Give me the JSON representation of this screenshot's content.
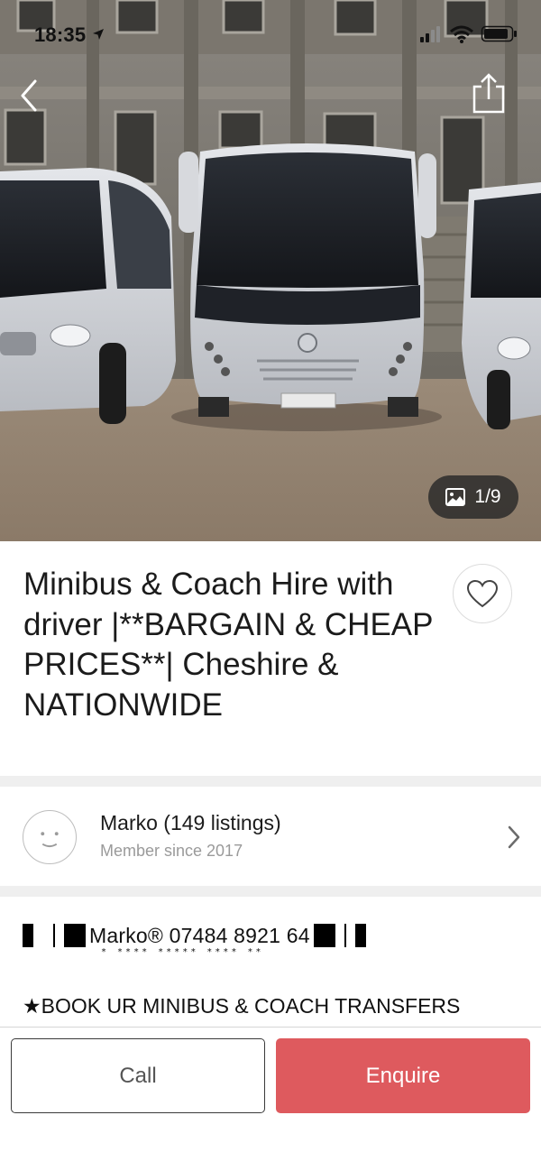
{
  "status_bar": {
    "time": "18:35",
    "icons": [
      "location-arrow-icon",
      "signal-icon",
      "wifi-icon",
      "battery-icon"
    ]
  },
  "nav": {
    "back_icon": "chevron-left-icon",
    "share_icon": "share-icon"
  },
  "gallery": {
    "counter": "1/9",
    "counter_icon": "image-icon"
  },
  "listing": {
    "title": "Minibus & Coach Hire with driver |**BARGAIN & CHEAP PRICES**| Cheshire & NATIONWIDE",
    "favourite_icon": "heart-icon"
  },
  "seller": {
    "name": "Marko (149 listings)",
    "since": "Member since 2017"
  },
  "description": {
    "line1_text": "Marko® 07484 8921 64",
    "line1_sub": "* **** ***** **** **",
    "line2": "★BOOK UR MINIBUS & COACH TRANSFERS"
  },
  "actions": {
    "call_label": "Call",
    "enquire_label": "Enquire"
  },
  "colors": {
    "accent": "#de5a5e",
    "separator": "#efefef",
    "muted_text": "#9a9a9a"
  }
}
